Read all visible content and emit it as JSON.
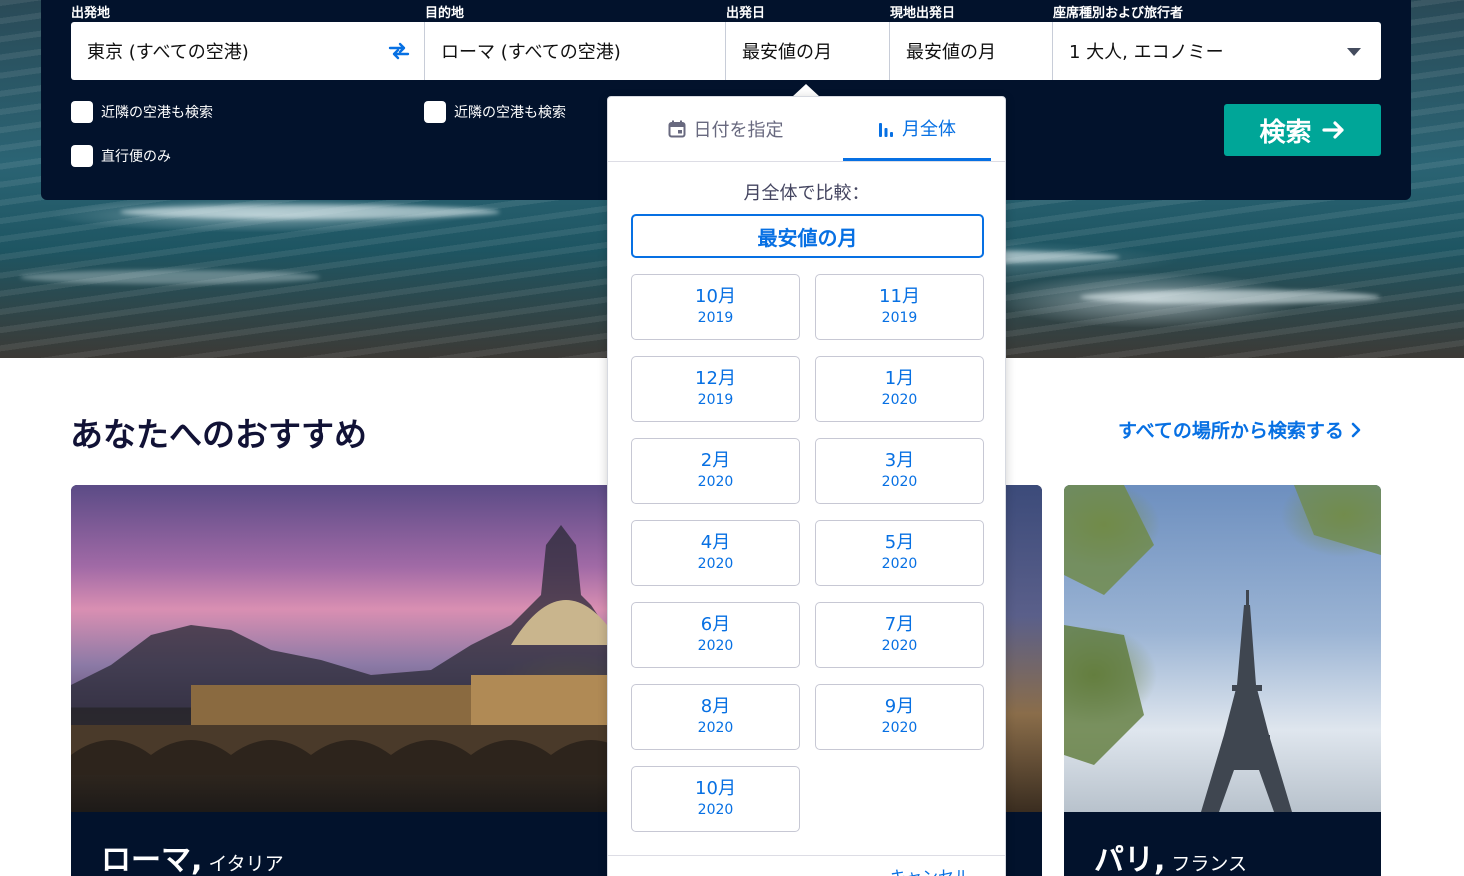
{
  "search": {
    "labels": {
      "origin": "出発地",
      "destination": "目的地",
      "depart": "出発日",
      "return": "現地出発日",
      "cabin": "座席種別および旅行者"
    },
    "origin_value": "東京 (すべての空港)",
    "destination_value": "ローマ (すべての空港)",
    "depart_value": "最安値の月",
    "return_value": "最安値の月",
    "cabin_value": "1 大人, エコノミー",
    "nearby_origin": "近隣の空港も検索",
    "nearby_destination": "近隣の空港も検索",
    "direct_only": "直行便のみ",
    "search_button": "検索"
  },
  "calendar": {
    "tab_dates": "日付を指定",
    "tab_month": "月全体",
    "compare_label": "月全体で比較：",
    "cheapest_month": "最安値の月",
    "months": [
      {
        "month": "10月",
        "year": "2019"
      },
      {
        "month": "11月",
        "year": "2019"
      },
      {
        "month": "12月",
        "year": "2019"
      },
      {
        "month": "1月",
        "year": "2020"
      },
      {
        "month": "2月",
        "year": "2020"
      },
      {
        "month": "3月",
        "year": "2020"
      },
      {
        "month": "4月",
        "year": "2020"
      },
      {
        "month": "5月",
        "year": "2020"
      },
      {
        "month": "6月",
        "year": "2020"
      },
      {
        "month": "7月",
        "year": "2020"
      },
      {
        "month": "8月",
        "year": "2020"
      },
      {
        "month": "9月",
        "year": "2020"
      },
      {
        "month": "10月",
        "year": "2020"
      }
    ],
    "cancel": "キャンセル"
  },
  "recommendations": {
    "title": "あなたへのおすすめ",
    "all_places_link": "すべての場所から検索する",
    "cards": [
      {
        "city": "ローマ,",
        "country": "イタリア"
      },
      {
        "city": "パリ,",
        "country": "フランス"
      }
    ]
  },
  "colors": {
    "panel_bg": "#02122c",
    "accent_blue": "#0770e3",
    "search_green": "#00a698"
  }
}
